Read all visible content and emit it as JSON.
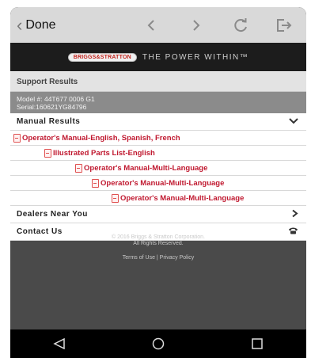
{
  "toolbar": {
    "done_label": "Done",
    "icons": [
      "chevron-left-icon",
      "chevron-right-icon",
      "refresh-icon",
      "share-out-icon"
    ]
  },
  "banner": {
    "logo_text": "BRIGGS&STRATTON",
    "tagline": "THE POWER WITHIN™"
  },
  "support": {
    "title": "Support Results",
    "model_line": "Model #: 44T677 0006 G1",
    "serial_line": "Serial:160621YG84796"
  },
  "manual_results": {
    "label": "Manual Results",
    "items": [
      "Operator's Manual-English, Spanish, French",
      "Illustrated Parts List-English",
      "Operator's Manual-Multi-Language",
      "Operator's Manual-Multi-Language",
      "Operator's Manual-Multi-Language"
    ]
  },
  "dealers": {
    "label": "Dealers Near You"
  },
  "contact": {
    "label": "Contact Us"
  },
  "footer": {
    "copyright": "© 2016 Briggs & Stratton Corporation.",
    "rights": "All Rights Reserved.",
    "links": "Terms of Use | Privacy Policy"
  },
  "colors": {
    "link_red": "#c0182f",
    "toolbar_bg": "#d9d9d9",
    "banner_bg": "#1c1c1c",
    "page_bg": "#4a4a4a"
  }
}
